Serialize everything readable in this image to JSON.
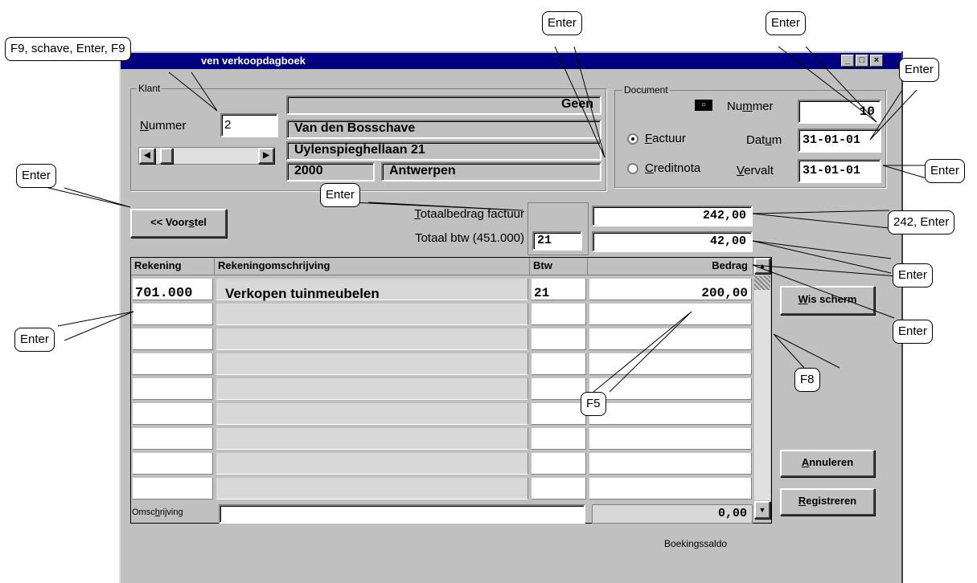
{
  "window": {
    "title": "ven verkoopdagboek",
    "controls": {
      "minimize": "_",
      "maximize": "□",
      "close": "×"
    }
  },
  "klant": {
    "group_label": "Klant",
    "nummer_label": "Nummer",
    "nummer_value": "2",
    "type": "Geen",
    "naam": "Van den Bosschave",
    "adres": "Uylenspieghellaan 21",
    "postcode": "2000",
    "gemeente": "Antwerpen"
  },
  "document": {
    "group_label": "Document",
    "nummer_label": "Nummer",
    "nummer_value": "10",
    "factuur_label": "Factuur",
    "creditnota_label": "Creditnota",
    "datum_label": "Datum",
    "datum_value": "31-01-01",
    "vervalt_label": "Vervalt",
    "vervalt_value": "31-01-01",
    "selected": "Factuur"
  },
  "buttons": {
    "voorstel": "<< Voorstel",
    "wis_scherm": "Wis scherm",
    "annuleren": "Annuleren",
    "registreren": "Registreren"
  },
  "totals": {
    "totaal_label": "Totaalbedrag factuur",
    "totaal_value": "242,00",
    "btw_label": "Totaal btw (451.000)",
    "btw_rate": "21",
    "btw_value": "42,00"
  },
  "table": {
    "headers": [
      "Rekening",
      "Rekeningomschrijving",
      "Btw",
      "Bedrag"
    ],
    "rows": [
      {
        "rekening": "701.000",
        "omschrijving": "Verkopen tuinmeubelen",
        "btw": "21",
        "bedrag": "200,00"
      }
    ]
  },
  "footer": {
    "omschrijving_label": "Omschrijving",
    "omschrijving_value": "",
    "saldo_value": "0,00",
    "saldo_label": "Boekingssaldo"
  },
  "callouts": {
    "c1": "F9, schave, Enter, F9",
    "c2": "Enter",
    "c3": "Enter",
    "c4": "Enter",
    "c5": "Enter",
    "c6": "Enter",
    "c7": "Enter",
    "c8": "242, Enter",
    "c9": "Enter",
    "c10": "Enter",
    "c11": "Enter",
    "c12": "F8",
    "c13": "F5",
    "c14": "Enter"
  }
}
